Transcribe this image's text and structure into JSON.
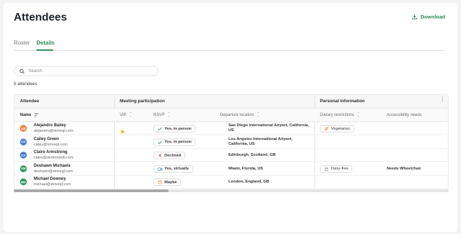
{
  "page": {
    "title": "Attendees",
    "download_label": "Download"
  },
  "tabs": [
    {
      "label": "Roster",
      "active": false
    },
    {
      "label": "Details",
      "active": true
    }
  ],
  "search": {
    "placeholder": "Search",
    "value": ""
  },
  "count_label": "5 attendees",
  "table": {
    "groups": {
      "attendee": "Attendee",
      "meeting": "Meeting participation",
      "personal": "Personal information"
    },
    "columns": {
      "name": "Name",
      "vip": "VIP",
      "rsvp": "RSVP",
      "departure": "Departure location",
      "dietary": "Dietary restrictions",
      "accessibility": "Accessibility needs"
    },
    "rows": [
      {
        "initials": "AB",
        "avatar_color": "#f0883e",
        "name": "Alejandro Bailey",
        "email": "alejandro@strivegl.com",
        "vip": true,
        "rsvp": "Yes, in person",
        "rsvp_icon": "check-icon",
        "flag": "us",
        "departure": "San Diego International Airport, California, US",
        "dietary": "Vegetarian",
        "dietary_icon": "leaf-icon",
        "accessibility": ""
      },
      {
        "initials": "CG",
        "avatar_color": "#4a7fd6",
        "name": "Cailey Green",
        "email": "cailey@strivegl.com",
        "vip": false,
        "rsvp": "Yes, in person",
        "rsvp_icon": "check-icon",
        "flag": "us",
        "departure": "Los Angeles International Airport, California, US",
        "dietary": "",
        "dietary_icon": "",
        "accessibility": ""
      },
      {
        "initials": "CA",
        "avatar_color": "#4a7fd6",
        "name": "Claire Armstrong",
        "email": "claire@dentonsedi.com",
        "vip": false,
        "rsvp": "Declined",
        "rsvp_icon": "x-icon",
        "flag": "gb",
        "departure": "Edinburgh, Scotland, GB",
        "dietary": "",
        "dietary_icon": "",
        "accessibility": ""
      },
      {
        "initials": "DM",
        "avatar_color": "#2e9a5e",
        "name": "Deshawn Michaels",
        "email": "deshawn@strivegl.com",
        "vip": false,
        "rsvp": "Yes, virtually",
        "rsvp_icon": "video-icon",
        "flag": "us",
        "departure": "Miami, Florida, US",
        "dietary": "Dairy-free",
        "dietary_icon": "carton-icon",
        "accessibility": "Needs Wheelchair"
      },
      {
        "initials": "MD",
        "avatar_color": "#2e9a5e",
        "name": "Michael Downey",
        "email": "michael@strivegl.com",
        "vip": false,
        "rsvp": "Maybe",
        "rsvp_icon": "question-icon",
        "flag": "gb",
        "departure": "London, England, GB",
        "dietary": "",
        "dietary_icon": "",
        "accessibility": ""
      }
    ]
  },
  "colors": {
    "accent": "#2e8a57",
    "vip_star": "#f2b51c",
    "declined": "#d9534f",
    "virtual": "#4a7fd6",
    "maybe": "#e8952f"
  }
}
